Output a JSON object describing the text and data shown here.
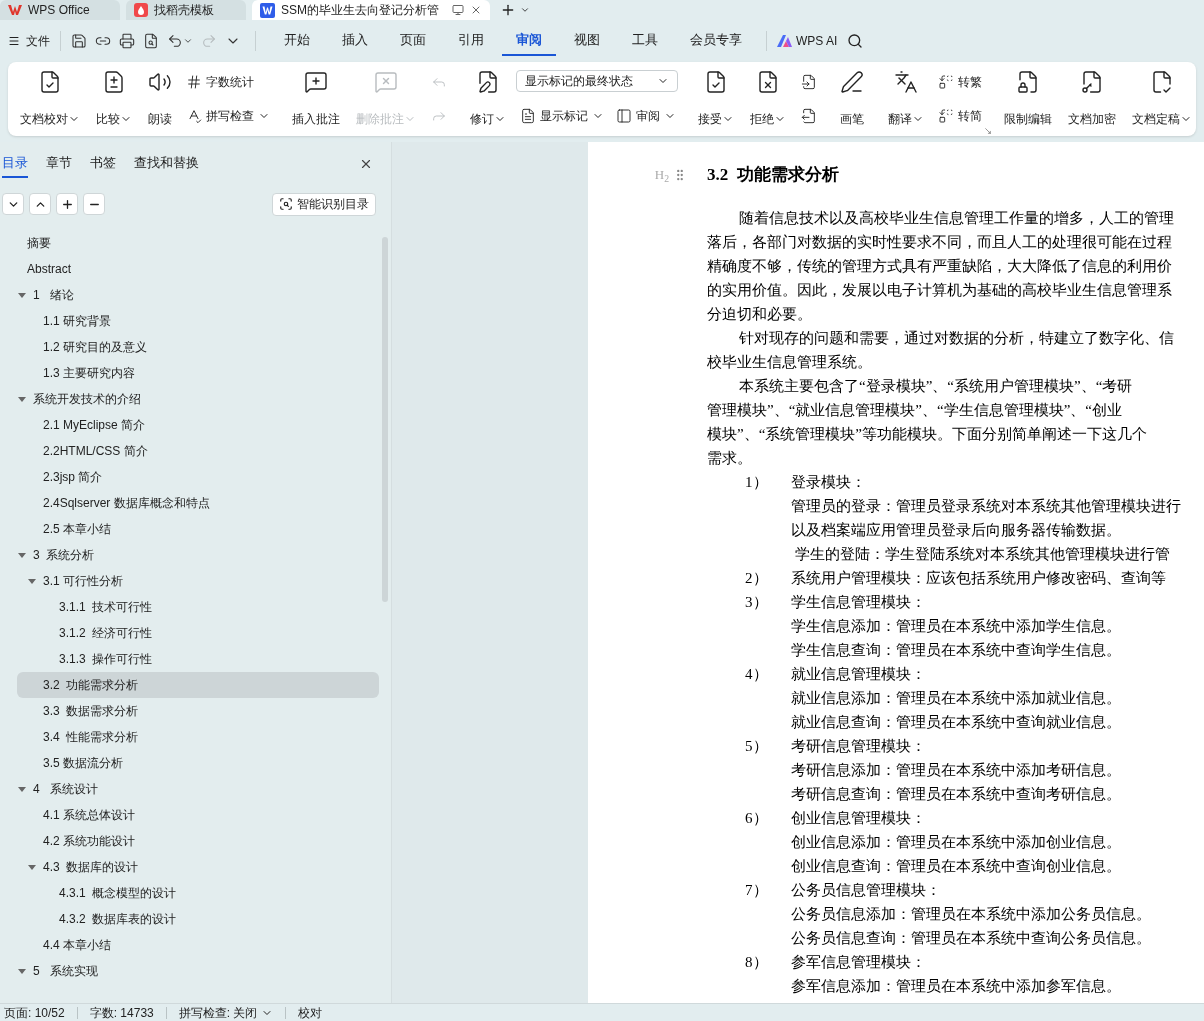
{
  "app_tabs": [
    {
      "title": "WPS Office",
      "selected": false
    },
    {
      "title": "找稻壳模板",
      "selected": false
    },
    {
      "title": "SSM的毕业生去向登记分析管",
      "selected": true
    }
  ],
  "menu": {
    "file": "文件",
    "quick_access": [
      {
        "disabled": false,
        "dropdown": false
      },
      {
        "disabled": false,
        "dropdown": false
      },
      {
        "disabled": false,
        "dropdown": false
      },
      {
        "disabled": false,
        "dropdown": false
      },
      {
        "disabled": false,
        "dropdown": true
      },
      {
        "disabled": true,
        "dropdown": false
      },
      {
        "disabled": false,
        "dropdown": false
      }
    ],
    "tabs": [
      {
        "label": "开始",
        "selected": false
      },
      {
        "label": "插入",
        "selected": false
      },
      {
        "label": "页面",
        "selected": false
      },
      {
        "label": "引用",
        "selected": false
      },
      {
        "label": "审阅",
        "selected": true
      },
      {
        "label": "视图",
        "selected": false
      },
      {
        "label": "工具",
        "selected": false
      },
      {
        "label": "会员专享",
        "selected": false
      }
    ],
    "ai": "WPS AI"
  },
  "ribbon": [
    {
      "launcher": false,
      "items": [
        {
          "kind": "large",
          "label": "文档校对",
          "dropdown": true,
          "disabled": false
        },
        {
          "kind": "large",
          "label": "比较",
          "dropdown": true,
          "disabled": false
        },
        {
          "kind": "large",
          "label": "朗读",
          "dropdown": false,
          "disabled": false
        },
        {
          "kind": "stack",
          "items": [
            {
              "kind": "small",
              "label": "字数统计",
              "dropdown": false,
              "disabled": false
            },
            {
              "kind": "small",
              "label": "拼写检查",
              "dropdown": true,
              "disabled": false
            }
          ]
        }
      ]
    },
    {
      "launcher": false,
      "items": [
        {
          "kind": "large",
          "label": "插入批注",
          "dropdown": false,
          "disabled": false
        },
        {
          "kind": "large",
          "label": "删除批注",
          "dropdown": true,
          "disabled": true
        },
        {
          "kind": "stack",
          "items": [
            {
              "kind": "icon",
              "dropdown": false,
              "disabled": true
            },
            {
              "kind": "icon",
              "dropdown": false,
              "disabled": true
            }
          ]
        }
      ]
    },
    {
      "launcher": false,
      "items": [
        {
          "kind": "large",
          "label": "修订",
          "dropdown": true,
          "disabled": false
        },
        {
          "kind": "stack",
          "items": [
            {
              "kind": "select",
              "value": "显示标记的最终状态"
            },
            {
              "kind": "row",
              "items": [
                {
                  "kind": "small",
                  "label": "显示标记",
                  "dropdown": true,
                  "disabled": false
                },
                {
                  "kind": "small",
                  "label": "审阅",
                  "dropdown": true,
                  "disabled": false
                }
              ]
            }
          ]
        }
      ]
    },
    {
      "launcher": false,
      "items": [
        {
          "kind": "large",
          "label": "接受",
          "dropdown": true,
          "disabled": false
        },
        {
          "kind": "large",
          "label": "拒绝",
          "dropdown": true,
          "disabled": false
        },
        {
          "kind": "stack",
          "items": [
            {
              "kind": "icon",
              "dropdown": false,
              "disabled": false
            },
            {
              "kind": "icon",
              "dropdown": false,
              "disabled": false
            }
          ]
        }
      ]
    },
    {
      "launcher": false,
      "items": [
        {
          "kind": "large",
          "label": "画笔",
          "dropdown": false,
          "disabled": false
        }
      ]
    },
    {
      "launcher": true,
      "items": [
        {
          "kind": "large",
          "label": "翻译",
          "dropdown": true,
          "disabled": false
        },
        {
          "kind": "stack",
          "items": [
            {
              "kind": "small",
              "label": "转繁",
              "dropdown": false,
              "disabled": false
            },
            {
              "kind": "small",
              "label": "转简",
              "dropdown": false,
              "disabled": false
            }
          ]
        }
      ]
    },
    {
      "launcher": false,
      "items": [
        {
          "kind": "large",
          "label": "限制编辑",
          "dropdown": false,
          "disabled": false
        },
        {
          "kind": "large",
          "label": "文档加密",
          "dropdown": false,
          "disabled": false
        },
        {
          "kind": "large",
          "label": "文档定稿",
          "dropdown": true,
          "disabled": false
        }
      ]
    }
  ],
  "nav_panel": {
    "tabs": [
      {
        "label": "目录",
        "selected": true
      },
      {
        "label": "章节",
        "selected": false
      },
      {
        "label": "书签",
        "selected": false
      },
      {
        "label": "查找和替换",
        "selected": false
      }
    ],
    "smart_button": "智能识别目录",
    "toc": [
      {
        "label": "摘要",
        "selected": false
      },
      {
        "label": "Abstract",
        "selected": false
      },
      {
        "label": "1   绪论",
        "selected": false,
        "expanded": true,
        "children": [
          {
            "label": "1.1 研究背景",
            "selected": false
          },
          {
            "label": "1.2 研究目的及意义",
            "selected": false
          },
          {
            "label": "1.3 主要研究内容",
            "selected": false
          }
        ]
      },
      {
        "label": "系统开发技术的介绍",
        "selected": false,
        "expanded": true,
        "children": [
          {
            "label": "2.1 MyEclipse 简介",
            "selected": false
          },
          {
            "label": "2.2HTML/CSS 简介",
            "selected": false
          },
          {
            "label": "2.3jsp 简介",
            "selected": false
          },
          {
            "label": "2.4Sqlserver 数据库概念和特点",
            "selected": false
          },
          {
            "label": "2.5 本章小结",
            "selected": false
          }
        ]
      },
      {
        "label": "3  系统分析",
        "selected": false,
        "expanded": true,
        "children": [
          {
            "label": "3.1 可行性分析",
            "selected": false,
            "expanded": true,
            "children": [
              {
                "label": "3.1.1  技术可行性",
                "selected": false
              },
              {
                "label": "3.1.2  经济可行性",
                "selected": false
              },
              {
                "label": "3.1.3  操作可行性",
                "selected": false
              }
            ]
          },
          {
            "label": "3.2  功能需求分析",
            "selected": true
          },
          {
            "label": "3.3  数据需求分析",
            "selected": false
          },
          {
            "label": "3.4  性能需求分析",
            "selected": false
          },
          {
            "label": "3.5 数据流分析",
            "selected": false
          }
        ]
      },
      {
        "label": "4   系统设计",
        "selected": false,
        "expanded": true,
        "children": [
          {
            "label": "4.1 系统总体设计",
            "selected": false
          },
          {
            "label": "4.2 系统功能设计",
            "selected": false
          },
          {
            "label": "4.3  数据库的设计",
            "selected": false,
            "expanded": true,
            "children": [
              {
                "label": "4.3.1  概念模型的设计",
                "selected": false
              },
              {
                "label": "4.3.2  数据库表的设计",
                "selected": false
              }
            ]
          },
          {
            "label": "4.4 本章小结",
            "selected": false
          }
        ]
      },
      {
        "label": "5   系统实现",
        "selected": false,
        "expanded": true
      }
    ]
  },
  "document": {
    "heading_marker": "H$_{2}$",
    "heading": "3.2  功能需求分析",
    "lines": [
      {
        "kind": "first",
        "text": "随着信息技术以及高校毕业生信息管理工作量的增多，人工的管理"
      },
      {
        "kind": "line",
        "text": "落后，各部门对数据的实时性要求不同，而且人工的处理很可能在过程"
      },
      {
        "kind": "line",
        "text": "精确度不够，传统的管理方式具有严重缺陷，大大降低了信息的利用价"
      },
      {
        "kind": "line",
        "text": "的实用价值。因此，发展以电子计算机为基础的高校毕业生信息管理系"
      },
      {
        "kind": "line",
        "text": "分迫切和必要。"
      },
      {
        "kind": "first",
        "text": "针对现存的问题和需要，通过对数据的分析，特建立了数字化、信"
      },
      {
        "kind": "line",
        "text": "校毕业生信息管理系统。"
      },
      {
        "kind": "first",
        "text": "本系统主要包含了“登录模块”、“系统用户管理模块”、“考研"
      },
      {
        "kind": "line",
        "text": "管理模块”、“就业信息管理模块”、“学生信息管理模块”、“创业"
      },
      {
        "kind": "line",
        "text": "模块”、“系统管理模块”等功能模块。下面分别简单阐述一下这几个"
      },
      {
        "kind": "line",
        "text": "需求。"
      },
      {
        "kind": "item",
        "number": "1）",
        "text": "登录模块："
      },
      {
        "kind": "sub",
        "text": "管理员的登录：管理员登录系统对本系统其他管理模块进行"
      },
      {
        "kind": "sub",
        "text": "以及档案端应用管理员登录后向服务器传输数据。"
      },
      {
        "kind": "sub",
        "text": " 学生的登陆：学生登陆系统对本系统其他管理模块进行管"
      },
      {
        "kind": "item",
        "number": "2）",
        "text": "系统用户管理模块：应该包括系统用户修改密码、查询等"
      },
      {
        "kind": "item",
        "number": "3）",
        "text": "学生信息管理模块："
      },
      {
        "kind": "sub",
        "text": "学生信息添加：管理员在本系统中添加学生信息。"
      },
      {
        "kind": "sub",
        "text": "学生信息查询：管理员在本系统中查询学生信息。"
      },
      {
        "kind": "item",
        "number": "4）",
        "text": "就业信息管理模块："
      },
      {
        "kind": "sub",
        "text": "就业信息添加：管理员在本系统中添加就业信息。"
      },
      {
        "kind": "sub",
        "text": "就业信息查询：管理员在本系统中查询就业信息。"
      },
      {
        "kind": "item",
        "number": "5）",
        "text": "考研信息管理模块："
      },
      {
        "kind": "sub",
        "text": "考研信息添加：管理员在本系统中添加考研信息。"
      },
      {
        "kind": "sub",
        "text": "考研信息查询：管理员在本系统中查询考研信息。"
      },
      {
        "kind": "item",
        "number": "6）",
        "text": "创业信息管理模块："
      },
      {
        "kind": "sub",
        "text": "创业信息添加：管理员在本系统中添加创业信息。"
      },
      {
        "kind": "sub",
        "text": "创业信息查询：管理员在本系统中查询创业信息。"
      },
      {
        "kind": "item",
        "number": "7）",
        "text": "公务员信息管理模块："
      },
      {
        "kind": "sub",
        "text": "公务员信息添加：管理员在本系统中添加公务员信息。"
      },
      {
        "kind": "sub",
        "text": "公务员信息查询：管理员在本系统中查询公务员信息。"
      },
      {
        "kind": "item",
        "number": "8）",
        "text": "参军信息管理模块："
      },
      {
        "kind": "sub",
        "text": "参军信息添加：管理员在本系统中添加参军信息。"
      }
    ]
  },
  "status_bar": [
    {
      "text": "页面: 10/52",
      "dropdown": false
    },
    {
      "text": "字数: 14733",
      "dropdown": false
    },
    {
      "text": "拼写检查: 关闭",
      "dropdown": true
    },
    {
      "text": "校对",
      "dropdown": false
    }
  ]
}
